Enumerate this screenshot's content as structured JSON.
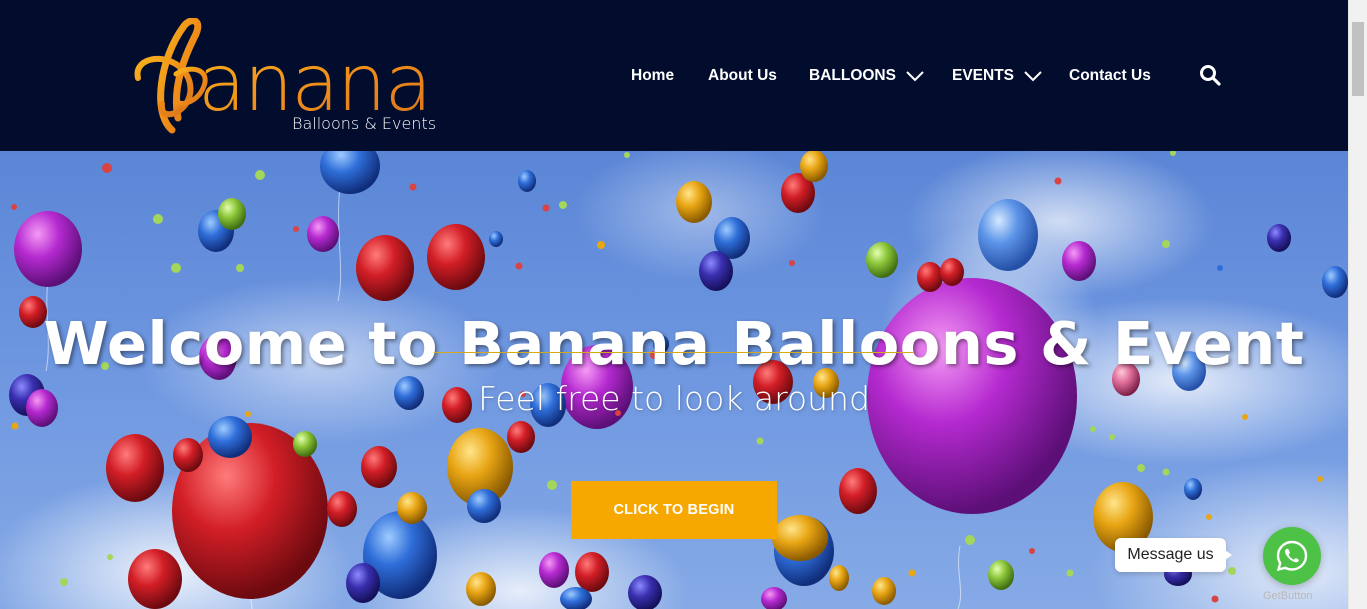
{
  "header": {
    "logo": {
      "wordmark": "Banana",
      "tagline": "Balloons & Events"
    },
    "nav": [
      {
        "label": "Home"
      },
      {
        "label": "About Us"
      },
      {
        "label": "BALLOONS",
        "has_dropdown": true
      },
      {
        "label": "EVENTS",
        "has_dropdown": true
      },
      {
        "label": "Contact Us"
      }
    ],
    "search_icon": "search-icon"
  },
  "hero": {
    "title": "Welcome to Banana Balloons & Event",
    "subtitle": "Feel free to look around",
    "cta_label": "CLICK TO BEGIN"
  },
  "widget": {
    "message_label": "Message us",
    "provider_label": "GetButton",
    "icon": "whatsapp-icon"
  },
  "colors": {
    "header_bg": "#020d2e",
    "accent": "#f7a800",
    "whatsapp": "#4dc247"
  }
}
